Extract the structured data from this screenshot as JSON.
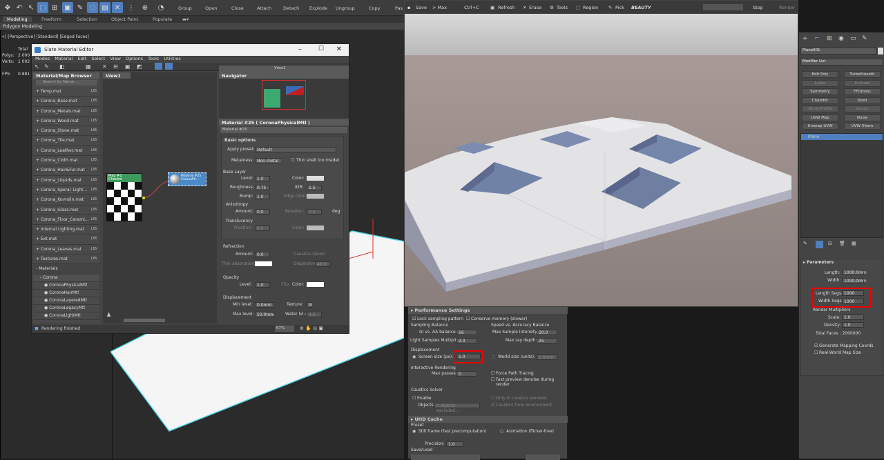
{
  "toolbar": {
    "group": "Group",
    "open": "Open",
    "close": "Close",
    "attach": "Attach",
    "detach": "Detach",
    "explode": "Explode",
    "ungroup": "Ungroup",
    "copy": "Copy",
    "paste": "Pas"
  },
  "ribbon": {
    "tabs": [
      "Modeling",
      "Freeform",
      "Selection",
      "Object Paint",
      "Populate"
    ],
    "subtitle": "Polygon Modeling"
  },
  "viewport": {
    "label": "+] [Perspective] [Standard] [Edged Faces]",
    "total": "Total",
    "polys_label": "Polys:",
    "polys_val": "2 000 0",
    "verts_label": "Verts:",
    "verts_val": "1 002 0",
    "fps_label": "FPS:",
    "fps_val": "0.881"
  },
  "sme": {
    "title": "Slate Material Editor",
    "menu": [
      "Modes",
      "Material",
      "Edit",
      "Select",
      "View",
      "Options",
      "Tools",
      "Utilities"
    ],
    "browser_title": "Material/Map Browser",
    "search_placeholder": "Search by Name ...",
    "lib": "LIB",
    "libs": [
      "+ Temp.mat",
      "+ Corona_Base.mat",
      "+ Corona_Metals.mat",
      "+ Corona_Wood.mat",
      "+ Corona_Stone.mat",
      "+ Corona_Tile.mat",
      "+ Corona_Leather.mat",
      "+ Corona_Cloth.mat",
      "+ Corona_Hair&Fur.mat",
      "+ Corona_Liquids.mat",
      "+ Corona_Speral_Light...",
      "+ Corona_Kovrolin.mat",
      "+ Corona_Glass.mat",
      "+ Corona_Floor_Cerami...",
      "+ Internal Lighting.mat",
      "+ Ext.mat",
      "+ Corona_Leaves.mat",
      "+ Textures.mat"
    ],
    "materials_label": "- Materials",
    "corona_label": "- Corona",
    "materials": [
      "CoronaPhysicalMtl",
      "CoronaHairMtl",
      "CoronaLayeredMtl",
      "CoronaLegacyMtl",
      "CoronaLightMtl"
    ],
    "view_tab": "View1",
    "view_dropdown": "View1",
    "navigator": "Navigator",
    "node1_a": "Map #1",
    "node1_b": "Checker",
    "node2_a": "Material #25",
    "node2_b": "CoronaPh...",
    "mat_title": "Material #25  ( CoronaPhysicalMtl )",
    "mat_name": "Material #25",
    "basic_options": "Basic options",
    "apply_preset": "Apply preset:",
    "preset_val": "Default",
    "metalness": "Metalness:",
    "metal_val": "Non-metal",
    "thin_shell": "Thin shell (no inside)",
    "base_layer": "Base Layer",
    "level": "Level:",
    "level_val": "1.0",
    "color": "Color:",
    "roughness": "Roughness:",
    "rough_val": "0.75",
    "ior": "IOR:",
    "ior_val": "1.5",
    "bump": "Bump:",
    "bump_val": "1.0",
    "edge_color": "Edge color:",
    "anisotropy": "Anisotropy",
    "amount": "Amount:",
    "amount_val": "0.0",
    "rotation": "Rotation:",
    "rotation_val": "0.0",
    "deg": "deg",
    "translucency": "Translucency",
    "fraction": "Fraction:",
    "fraction_val": "0.0",
    "refraction": "Refraction",
    "ref_amount_val": "0.0",
    "caustics": "Caustics (slow)",
    "thin_absorption": "Thin absorption:",
    "dispersion": "Dispersion",
    "disp_val": "40.0",
    "opacity": "Opacity",
    "op_level_val": "1.0",
    "clip": "Clip",
    "displacement": "Displacement",
    "min_level": "Min level:",
    "min_val": "0.0mm",
    "texture": "Texture:",
    "texture_val": "M",
    "max_level": "Max level:",
    "max_val": "50.0mm",
    "water_lvl": "Water lvl.:",
    "water_val": "0.5",
    "status": "Rendering finished",
    "zoom": "67%"
  },
  "render": {
    "save": "Save",
    "tomax": "> Max",
    "ctrlc": "Ctrl+C",
    "refresh": "Refresh",
    "erase": "Erase",
    "tools": "Tools",
    "region": "Region",
    "pick": "Pick",
    "beauty": "BEAUTY",
    "stop": "Stop",
    "render": "Render"
  },
  "perf": {
    "title": "Performance Settings",
    "lock": "Lock sampling pattern",
    "conserve": "Conserve memory (slower)",
    "sampling": "Sampling Balance",
    "speed": "Speed vs. Accuracy Balance",
    "gi_aa": "GI vs. AA balance:",
    "gi_val": "16",
    "max_sample": "Max Sample Intensity:",
    "max_sample_val": "20.0",
    "light_samples": "Light Samples Multiplier:",
    "light_val": "2.0",
    "max_ray": "Max ray depth:",
    "max_ray_val": "25",
    "displacement": "Displacement",
    "screen_size": "Screen size (px):",
    "screen_val": "1.0",
    "world_size": "World size (units):",
    "world_val": "1.0mm",
    "interactive": "Interactive Rendering",
    "max_passes": "Max passes:",
    "passes_val": "0",
    "force_path": "Force Path Tracing",
    "fast_preview": "Fast preview denoise during render",
    "caustics": "Caustics Solver",
    "enable": "Enable",
    "only_caustics": "Only in caustics element",
    "objects": "Objects:",
    "objects_val": "0 objects excluded...",
    "caustics_env": "Caustics from environment",
    "uhd": "UHD Cache",
    "preset": "Preset",
    "still": "Still frame (fast precomputation)",
    "animation": "Animation (flicker-free)",
    "precision": "Precision:",
    "precision_val": "1.0",
    "saveload": "Save/Load"
  },
  "cmd": {
    "object_name": "Plane001",
    "modifier_list": "Modifier List",
    "mods": [
      "Edit Poly",
      "TurboSmooth",
      "Lathe",
      "Extrude",
      "Symmetry",
      "FFD(box)",
      "Chamfer",
      "Shell",
      "Bevel Profile",
      "Sweep",
      "UVW Map",
      "Noise",
      "Unwrap UVW",
      "UVW Xform"
    ],
    "stack_item": "Plane",
    "parameters": "Parameters",
    "length": "Length:",
    "length_val": "1000.0mm",
    "width": "Width:",
    "width_val": "1000.0mm",
    "length_segs": "Length Segs:",
    "lsegs_val": "1000",
    "width_segs": "Width Segs:",
    "wsegs_val": "1000",
    "render_mult": "Render Multipliers",
    "scale": "Scale:",
    "scale_val": "1.0",
    "density": "Density:",
    "density_val": "1.0",
    "total_faces": "Total Faces : 2000000",
    "gen_map": "Generate Mapping Coords.",
    "real_world": "Real-World Map Size"
  },
  "colors": {
    "accent": "#4f7fbf",
    "highlight": "#e00000",
    "node_green": "#3d9a5c"
  }
}
